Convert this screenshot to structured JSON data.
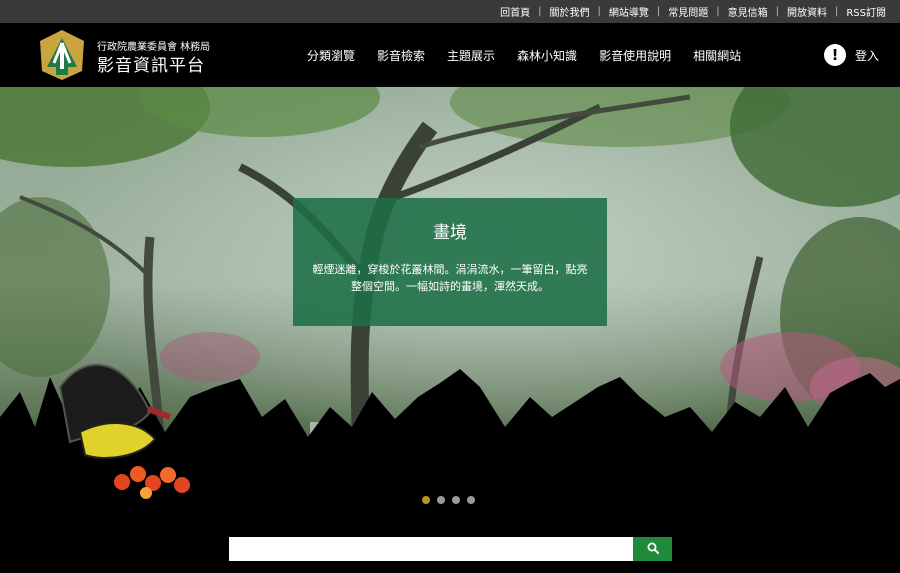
{
  "utility_links": [
    "回首頁",
    "關於我們",
    "網站導覽",
    "常見問題",
    "意見信箱",
    "開放資料",
    "RSS訂閱"
  ],
  "header": {
    "org_name": "行政院農業委員會 林務局",
    "site_title": "影音資訊平台",
    "nav": [
      "分類瀏覽",
      "影音檢索",
      "主題展示",
      "森林小知識",
      "影音使用說明",
      "相關網站"
    ],
    "alert_glyph": "!",
    "login_label": "登入"
  },
  "hero": {
    "title": "畫境",
    "text": "輕煙迷離，穿梭於花叢林間。涓涓流水，一筆留白，點亮整個空間。一幅如詩的畫境，渾然天成。",
    "slide_count": 4,
    "active_slide": 1
  },
  "search": {
    "value": "",
    "placeholder": "",
    "icon": "search-icon"
  },
  "colors": {
    "topbar": "#3a3a3a",
    "caption_bg": "#1c6e46",
    "search_button": "#1e8a3a",
    "active_dot": "#b8962e",
    "logo_gold": "#c9a441",
    "logo_green": "#1f7a45"
  }
}
